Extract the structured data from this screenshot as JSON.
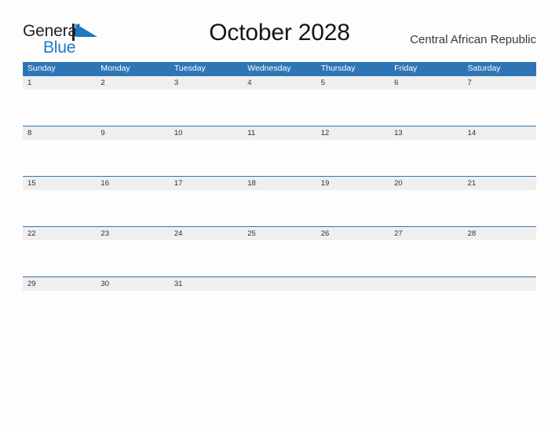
{
  "brand": {
    "name_part1": "General",
    "name_part2": "Blue",
    "flag_icon": "blue-triangle-flag-icon",
    "color_dark": "#231f20",
    "color_blue": "#1b7ac4"
  },
  "header": {
    "title": "October 2028",
    "subtitle": "Central African Republic"
  },
  "calendar": {
    "accent_color": "#2e75b6",
    "row_band_color": "#efefef",
    "weekdays": [
      "Sunday",
      "Monday",
      "Tuesday",
      "Wednesday",
      "Thursday",
      "Friday",
      "Saturday"
    ],
    "weeks": [
      {
        "cells": [
          {
            "day": "1"
          },
          {
            "day": "2"
          },
          {
            "day": "3"
          },
          {
            "day": "4"
          },
          {
            "day": "5"
          },
          {
            "day": "6"
          },
          {
            "day": "7"
          }
        ]
      },
      {
        "cells": [
          {
            "day": "8"
          },
          {
            "day": "9"
          },
          {
            "day": "10"
          },
          {
            "day": "11"
          },
          {
            "day": "12"
          },
          {
            "day": "13"
          },
          {
            "day": "14"
          }
        ]
      },
      {
        "cells": [
          {
            "day": "15"
          },
          {
            "day": "16"
          },
          {
            "day": "17"
          },
          {
            "day": "18"
          },
          {
            "day": "19"
          },
          {
            "day": "20"
          },
          {
            "day": "21"
          }
        ]
      },
      {
        "cells": [
          {
            "day": "22"
          },
          {
            "day": "23"
          },
          {
            "day": "24"
          },
          {
            "day": "25"
          },
          {
            "day": "26"
          },
          {
            "day": "27"
          },
          {
            "day": "28"
          }
        ]
      },
      {
        "cells": [
          {
            "day": "29"
          },
          {
            "day": "30"
          },
          {
            "day": "31"
          },
          {
            "day": ""
          },
          {
            "day": ""
          },
          {
            "day": ""
          },
          {
            "day": ""
          }
        ]
      }
    ]
  }
}
